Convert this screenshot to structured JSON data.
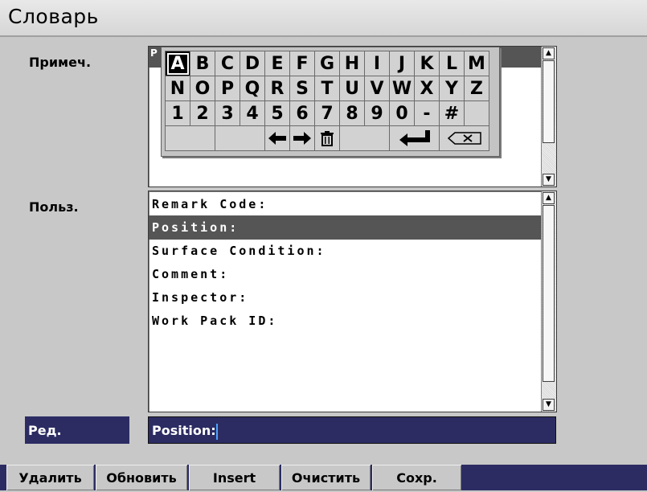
{
  "window": {
    "title": "Словарь"
  },
  "labels": {
    "notes": "Примеч.",
    "user": "Польз.",
    "edit": "Ред."
  },
  "notes_field": {
    "value": "P"
  },
  "keyboard": {
    "row1": [
      "A",
      "B",
      "C",
      "D",
      "E",
      "F",
      "G",
      "H",
      "I",
      "J",
      "K",
      "L",
      "M"
    ],
    "row2": [
      "N",
      "O",
      "P",
      "Q",
      "R",
      "S",
      "T",
      "U",
      "V",
      "W",
      "X",
      "Y",
      "Z"
    ],
    "row3": [
      "1",
      "2",
      "3",
      "4",
      "5",
      "6",
      "7",
      "8",
      "9",
      "0",
      "-",
      "#",
      ""
    ],
    "selected": "A",
    "row4_icons": [
      "arrow-left-icon",
      "arrow-right-icon",
      "trash-icon",
      "enter-icon",
      "backspace-icon"
    ]
  },
  "user_list": {
    "items": [
      "Remark Code:",
      "Position:",
      "Surface Condition:",
      "Comment:",
      "Inspector:",
      "Work Pack ID:"
    ],
    "selected_index": 1
  },
  "edit": {
    "value": "Position:"
  },
  "softkeys": [
    "Удалить",
    "Обновить",
    "Insert",
    "Очистить",
    "Сохр."
  ],
  "colors": {
    "accent": "#2c2c63",
    "selected_row": "#555555",
    "background": "#c8c8c8"
  }
}
